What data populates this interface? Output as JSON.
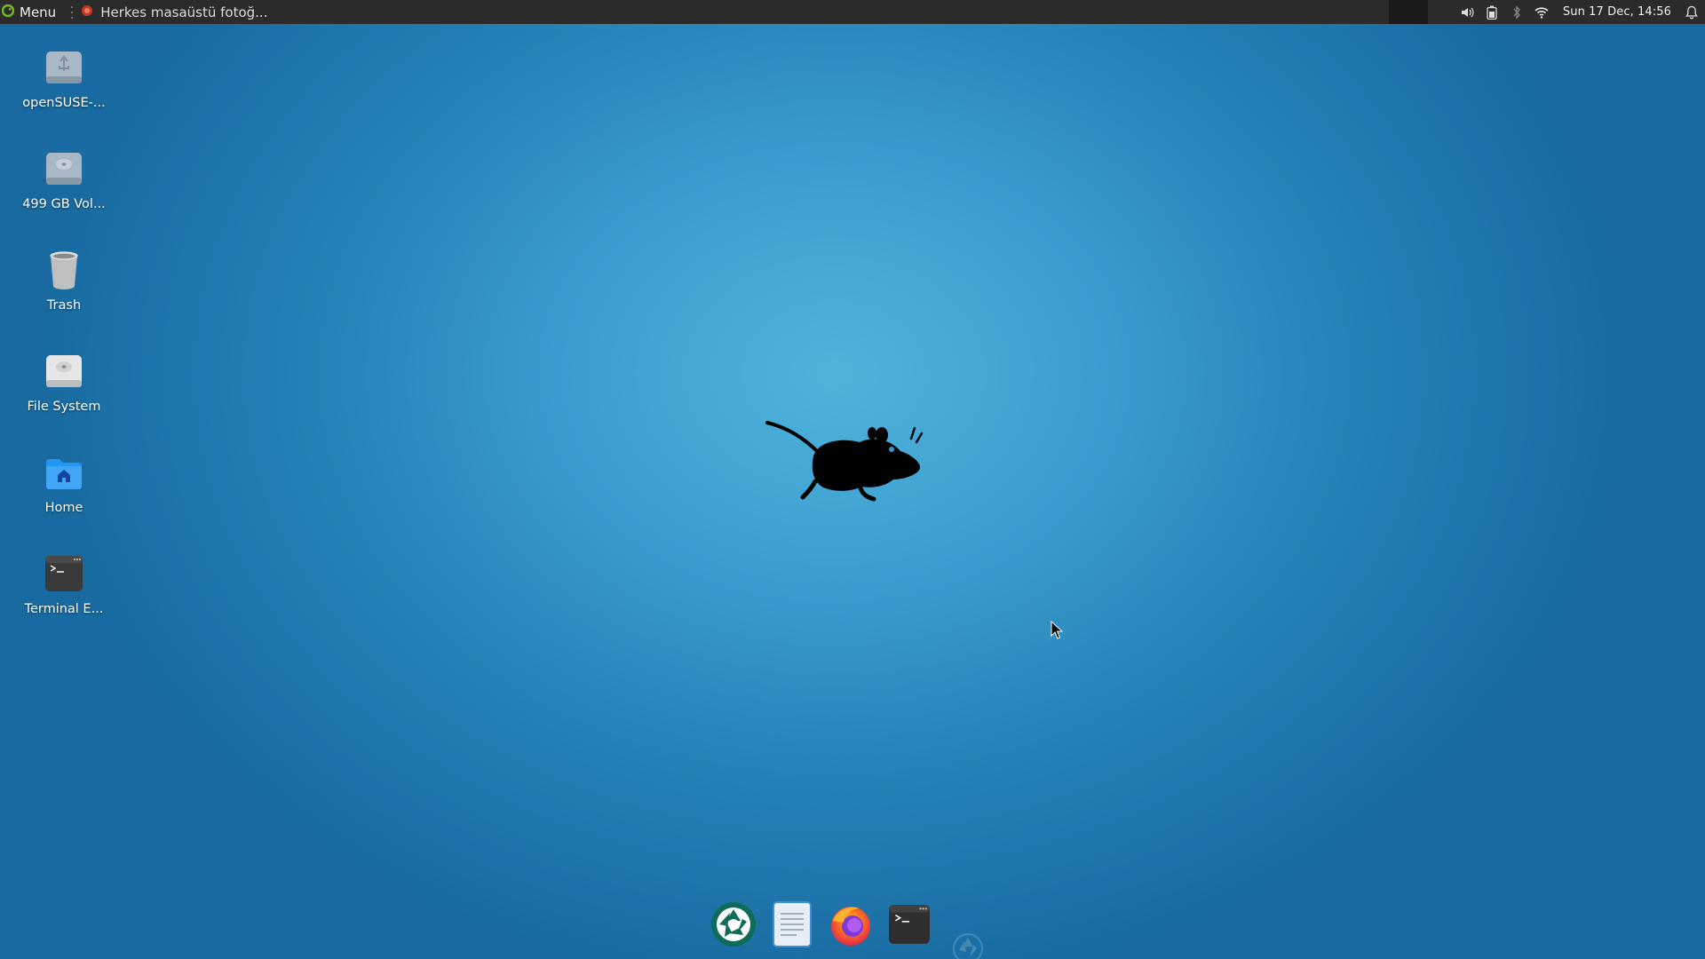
{
  "panel": {
    "menu_label": "Menu",
    "task_title": "Herkes masaüstü fotoğ...",
    "clock": "Sun 17 Dec, 14:56",
    "tray_icons": [
      "volume-icon",
      "battery-icon",
      "bluetooth-icon",
      "wifi-icon",
      "notification-bell-icon"
    ]
  },
  "desktop": {
    "icons": [
      {
        "label": "openSUSE-...",
        "icon": "usb-drive-icon"
      },
      {
        "label": "499 GB Vol...",
        "icon": "hard-drive-icon"
      },
      {
        "label": "Trash",
        "icon": "trash-icon"
      },
      {
        "label": "File System",
        "icon": "filesystem-drive-icon"
      },
      {
        "label": "Home",
        "icon": "home-folder-icon"
      },
      {
        "label": "Terminal E...",
        "icon": "terminal-icon"
      }
    ]
  },
  "dock": {
    "items": [
      {
        "name": "screenshot-app",
        "icon": "aperture-icon"
      },
      {
        "name": "text-editor",
        "icon": "document-icon"
      },
      {
        "name": "firefox",
        "icon": "firefox-icon"
      },
      {
        "name": "terminal",
        "icon": "terminal-icon"
      }
    ]
  },
  "colors": {
    "panel_bg": "#2b2b2b",
    "wallpaper_center": "#4fb3dc",
    "wallpaper_edge": "#186aa0",
    "accent_green": "#73ba25"
  }
}
